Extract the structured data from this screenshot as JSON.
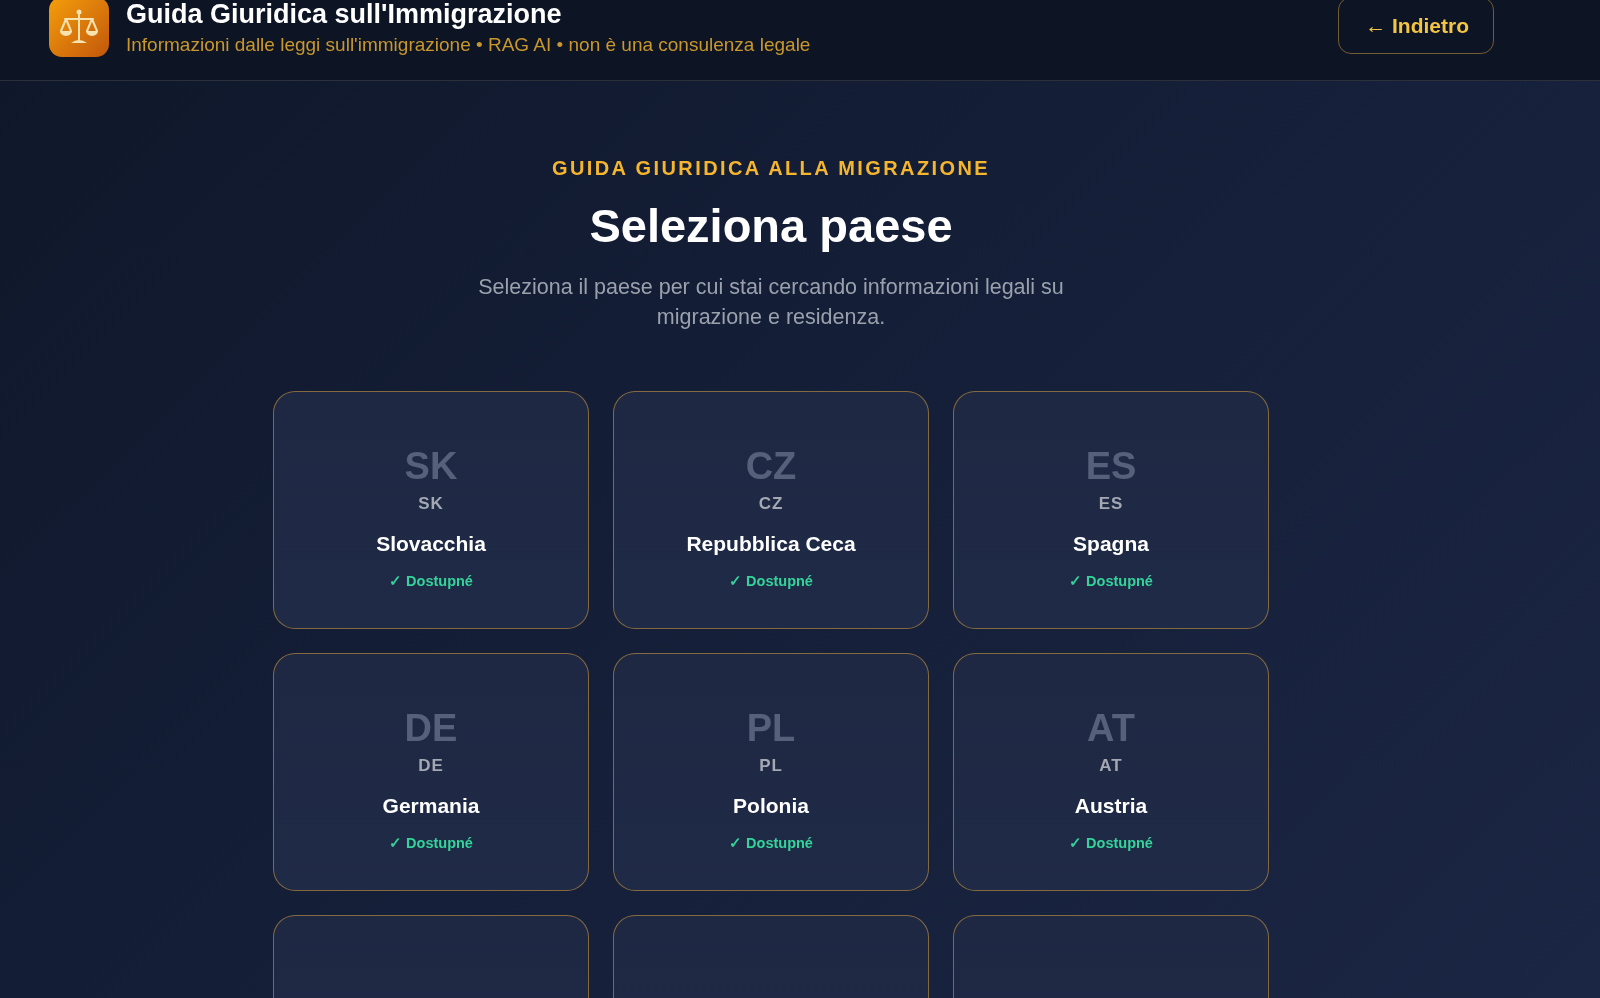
{
  "header": {
    "title": "Guida Giuridica sull'Immigrazione",
    "subtitle": "Informazioni dalle leggi sull'immigrazione • RAG AI • non è una consulenza legale",
    "back_button": "← Indietro"
  },
  "intro": {
    "eyebrow": "GUIDA GIURIDICA ALLA MIGRAZIONE",
    "title": "Seleziona paese",
    "description": "Seleziona il paese per cui stai cercando informazioni legali su migrazione e residenza."
  },
  "countries": [
    {
      "kind": "full",
      "flag": "SK",
      "code": "SK",
      "name": "Slovacchia",
      "status": "✓ Dostupné",
      "available": true
    },
    {
      "kind": "full",
      "flag": "CZ",
      "code": "CZ",
      "name": "Repubblica Ceca",
      "status": "✓ Dostupné",
      "available": true
    },
    {
      "kind": "full",
      "flag": "ES",
      "code": "ES",
      "name": "Spagna",
      "status": "✓ Dostupné",
      "available": true
    },
    {
      "kind": "full",
      "flag": "DE",
      "code": "DE",
      "name": "Germania",
      "status": "✓ Dostupné",
      "available": true
    },
    {
      "kind": "full",
      "flag": "PL",
      "code": "PL",
      "name": "Polonia",
      "status": "✓ Dostupné",
      "available": true
    },
    {
      "kind": "full",
      "flag": "AT",
      "code": "AT",
      "name": "Austria",
      "status": "✓ Dostupné",
      "available": true
    },
    {
      "kind": "partial"
    },
    {
      "kind": "partial"
    },
    {
      "kind": "partial"
    }
  ]
}
